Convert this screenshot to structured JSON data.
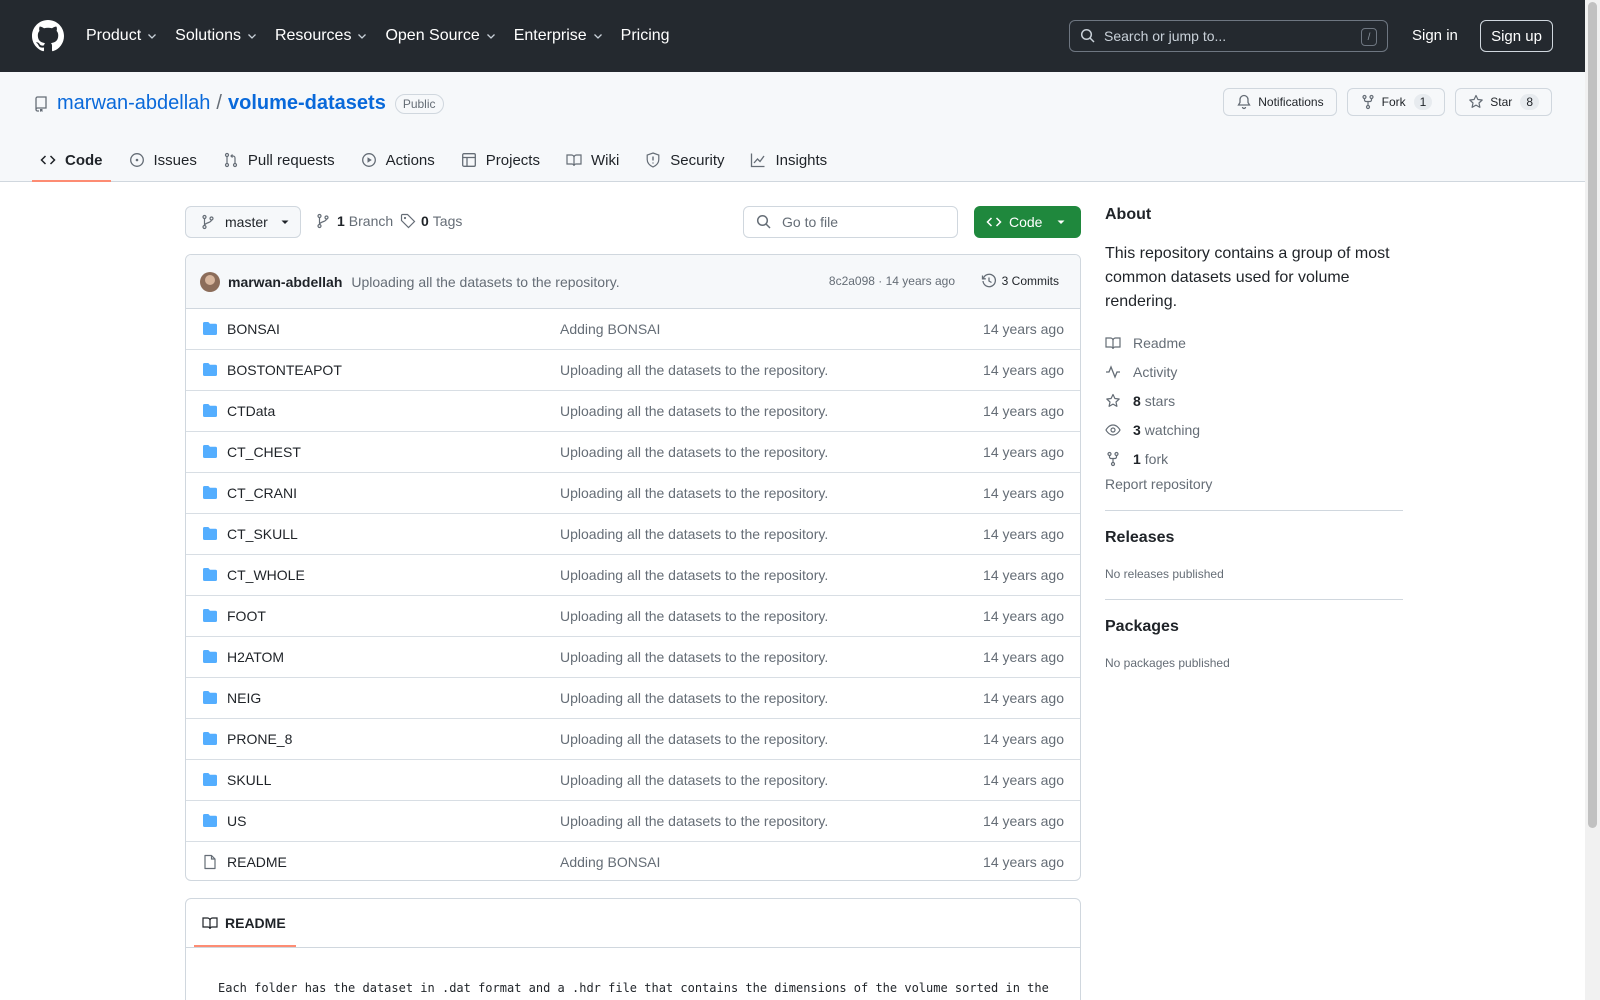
{
  "header": {
    "nav": [
      "Product",
      "Solutions",
      "Resources",
      "Open Source",
      "Enterprise",
      "Pricing"
    ],
    "nav_has_chevron": [
      true,
      true,
      true,
      true,
      true,
      false
    ],
    "search_placeholder": "Search or jump to...",
    "search_shortcut": "/",
    "sign_in": "Sign in",
    "sign_up": "Sign up"
  },
  "repo": {
    "owner": "marwan-abdellah",
    "separator": "/",
    "name": "volume-datasets",
    "visibility": "Public",
    "notifications_label": "Notifications",
    "fork_label": "Fork",
    "fork_count": "1",
    "star_label": "Star",
    "star_count": "8"
  },
  "tabs": [
    "Code",
    "Issues",
    "Pull requests",
    "Actions",
    "Projects",
    "Wiki",
    "Security",
    "Insights"
  ],
  "toolbar": {
    "branch": "master",
    "branch_count": "1",
    "branch_label": "Branch",
    "tag_count": "0",
    "tag_label": "Tags",
    "go_to_file": "Go to file",
    "code_button": "Code"
  },
  "commit": {
    "author": "marwan-abdellah",
    "message": "Uploading all the datasets to the repository.",
    "meta": "8c2a098 · 14 years ago",
    "commits": "3 Commits"
  },
  "files": [
    {
      "name": "BONSAI",
      "type": "folder",
      "message": "Adding BONSAI",
      "date": "14 years ago"
    },
    {
      "name": "BOSTONTEAPOT",
      "type": "folder",
      "message": "Uploading all the datasets to the repository.",
      "date": "14 years ago"
    },
    {
      "name": "CTData",
      "type": "folder",
      "message": "Uploading all the datasets to the repository.",
      "date": "14 years ago"
    },
    {
      "name": "CT_CHEST",
      "type": "folder",
      "message": "Uploading all the datasets to the repository.",
      "date": "14 years ago"
    },
    {
      "name": "CT_CRANI",
      "type": "folder",
      "message": "Uploading all the datasets to the repository.",
      "date": "14 years ago"
    },
    {
      "name": "CT_SKULL",
      "type": "folder",
      "message": "Uploading all the datasets to the repository.",
      "date": "14 years ago"
    },
    {
      "name": "CT_WHOLE",
      "type": "folder",
      "message": "Uploading all the datasets to the repository.",
      "date": "14 years ago"
    },
    {
      "name": "FOOT",
      "type": "folder",
      "message": "Uploading all the datasets to the repository.",
      "date": "14 years ago"
    },
    {
      "name": "H2ATOM",
      "type": "folder",
      "message": "Uploading all the datasets to the repository.",
      "date": "14 years ago"
    },
    {
      "name": "NEIG",
      "type": "folder",
      "message": "Uploading all the datasets to the repository.",
      "date": "14 years ago"
    },
    {
      "name": "PRONE_8",
      "type": "folder",
      "message": "Uploading all the datasets to the repository.",
      "date": "14 years ago"
    },
    {
      "name": "SKULL",
      "type": "folder",
      "message": "Uploading all the datasets to the repository.",
      "date": "14 years ago"
    },
    {
      "name": "US",
      "type": "folder",
      "message": "Uploading all the datasets to the repository.",
      "date": "14 years ago"
    },
    {
      "name": "README",
      "type": "file",
      "message": "Adding BONSAI",
      "date": "14 years ago"
    }
  ],
  "readme": {
    "tab_label": "README",
    "text": "Each folder has the dataset in .dat format and a .hdr file that contains the dimensions of the volume sorted in the"
  },
  "about": {
    "heading": "About",
    "description": "This repository contains a group of most common datasets used for volume rendering.",
    "readme": "Readme",
    "activity": "Activity",
    "stars_count": "8",
    "stars_label": "stars",
    "watching_count": "3",
    "watching_label": "watching",
    "forks_count": "1",
    "forks_label": "fork",
    "report": "Report repository"
  },
  "releases": {
    "heading": "Releases",
    "empty": "No releases published"
  },
  "packages": {
    "heading": "Packages",
    "empty": "No packages published"
  },
  "colors": {
    "header_bg": "#24292f",
    "link": "#0969da",
    "folder": "#54aeff",
    "green_button": "#1f883d",
    "tab_underline": "#fd8c73"
  }
}
